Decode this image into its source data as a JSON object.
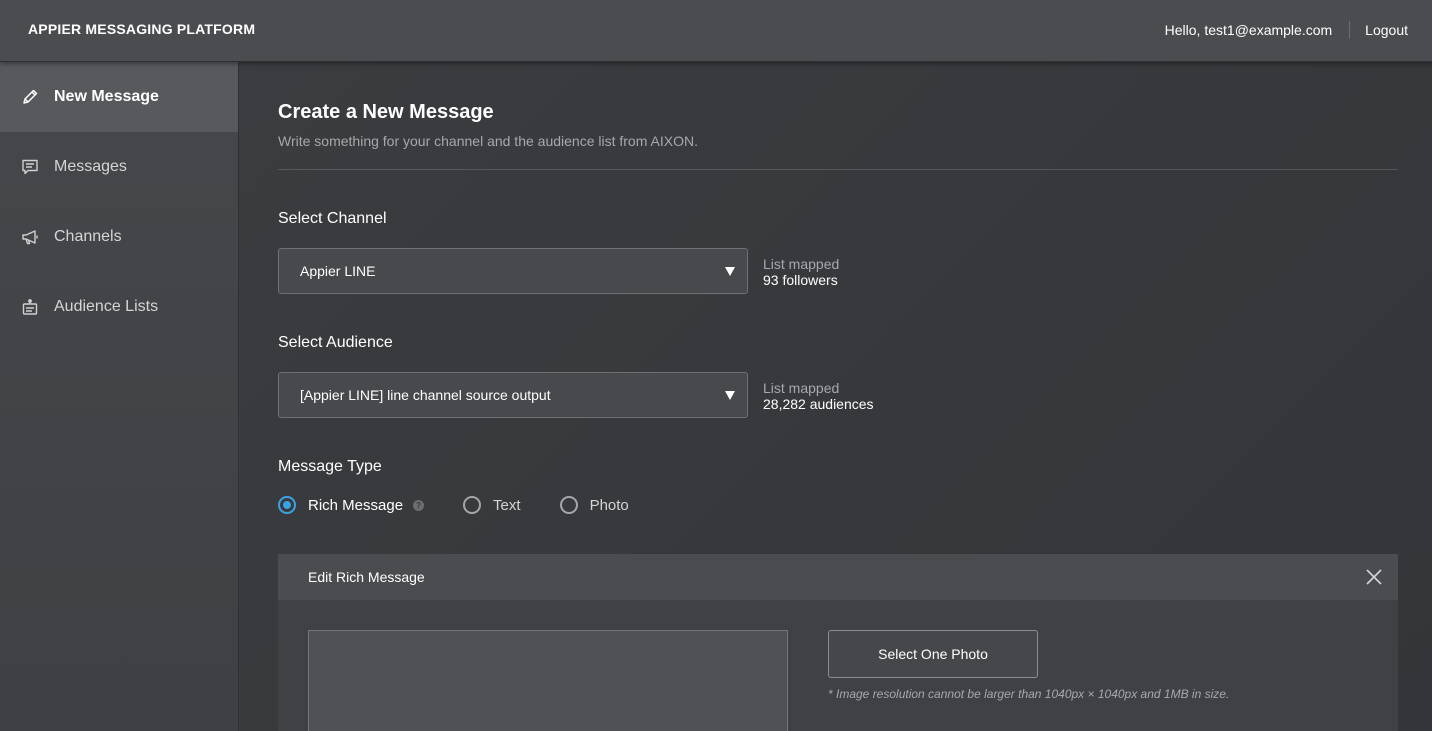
{
  "header": {
    "brand": "APPIER MESSAGING PLATFORM",
    "greeting": "Hello, test1@example.com",
    "logout": "Logout"
  },
  "sidebar": {
    "items": [
      {
        "label": "New Message",
        "icon": "pencil-icon",
        "active": true
      },
      {
        "label": "Messages",
        "icon": "message-icon",
        "active": false
      },
      {
        "label": "Channels",
        "icon": "megaphone-icon",
        "active": false
      },
      {
        "label": "Audience Lists",
        "icon": "audience-list-icon",
        "active": false
      }
    ]
  },
  "page": {
    "title": "Create a New Message",
    "subtitle": "Write something for your channel and the audience list from AIXON."
  },
  "channel": {
    "label": "Select Channel",
    "value": "Appier LINE",
    "mapped_label": "List mapped",
    "mapped_value": "93 followers"
  },
  "audience": {
    "label": "Select Audience",
    "value": "[Appier LINE] line channel source output",
    "mapped_label": "List mapped",
    "mapped_value": "28,282 audiences"
  },
  "message_type": {
    "label": "Message Type",
    "options": [
      {
        "label": "Rich Message",
        "checked": true
      },
      {
        "label": "Text",
        "checked": false
      },
      {
        "label": "Photo",
        "checked": false
      }
    ],
    "help_glyph": "?"
  },
  "editor": {
    "title": "Edit Rich Message",
    "select_photo": "Select One Photo",
    "note": "* Image resolution cannot be larger than 1040px × 1040px and 1MB in size."
  },
  "colors": {
    "accent": "#3aa3e3",
    "background": "#3a3c3f",
    "topbar": "#4a4c4f"
  }
}
